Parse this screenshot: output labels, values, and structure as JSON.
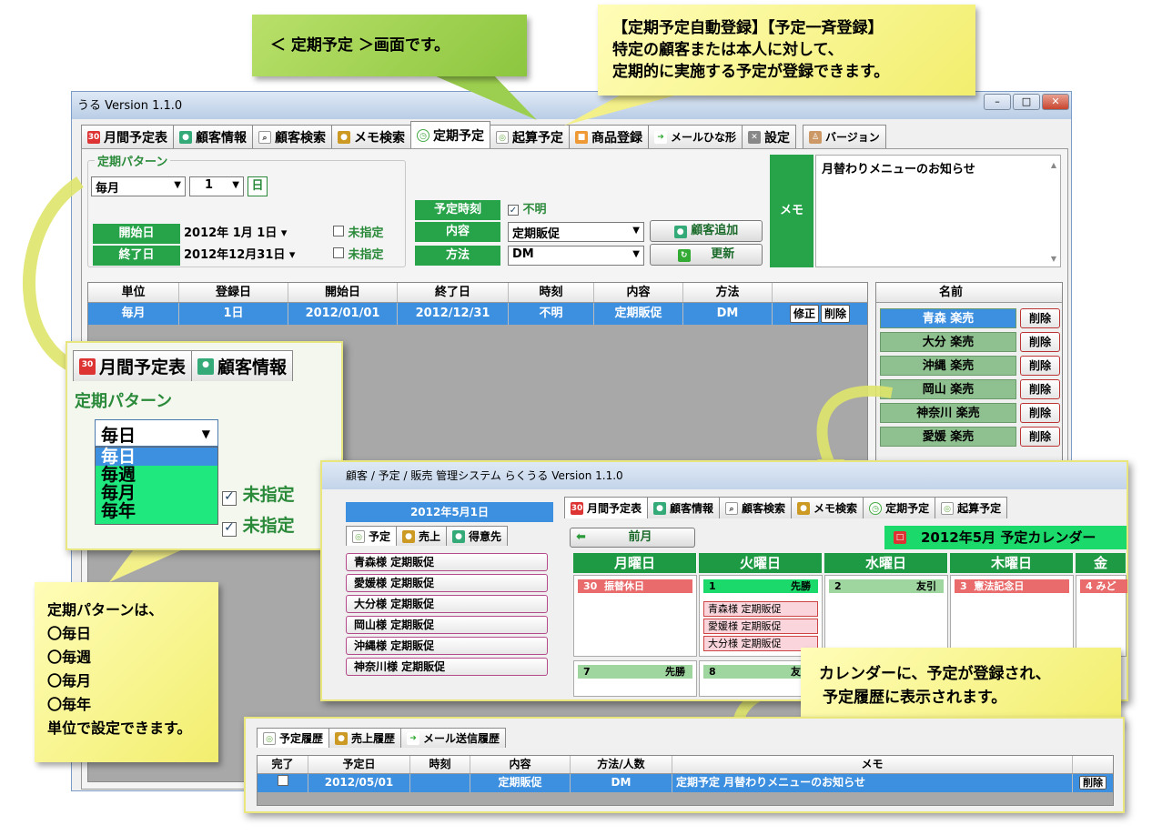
{
  "main_window": {
    "title": "うる Version 1.1.0",
    "tabs": [
      {
        "label": "月間予定表",
        "icon": "calendar-icon"
      },
      {
        "label": "顧客情報",
        "icon": "people-icon"
      },
      {
        "label": "顧客検索",
        "icon": "search-icon"
      },
      {
        "label": "メモ検索",
        "icon": "memo-search-icon"
      },
      {
        "label": "定期予定",
        "icon": "clock-icon"
      },
      {
        "label": "起算予定",
        "icon": "count-icon"
      },
      {
        "label": "商品登録",
        "icon": "gift-icon"
      },
      {
        "label": "メールひな形",
        "icon": "mail-icon"
      },
      {
        "label": "設定",
        "icon": "tools-icon"
      },
      {
        "label": "バージョン",
        "icon": "version-icon"
      }
    ],
    "active_tab": "定期予定",
    "pattern_group_label": "定期パターン",
    "pattern_unit": "毎月",
    "pattern_count": "1",
    "pattern_day_label": "日",
    "start_label": "開始日",
    "start_value": "2012年 1月 1日",
    "end_label": "終了日",
    "end_value": "2012年12月31日",
    "unspecified_label": "未指定",
    "time_label": "予定時刻",
    "time_unknown_label": "不明",
    "content_label": "内容",
    "content_value": "定期販促",
    "method_label": "方法",
    "method_value": "DM",
    "add_customer_label": "顧客追加",
    "update_label": "更新",
    "memo_label": "メモ",
    "memo_text": "月替わりメニューのお知らせ",
    "schedule_table": {
      "headers": [
        "単位",
        "登録日",
        "開始日",
        "終了日",
        "時刻",
        "内容",
        "方法"
      ],
      "rows": [
        {
          "cells": [
            "毎月",
            "1日",
            "2012/01/01",
            "2012/12/31",
            "不明",
            "定期販促",
            "DM"
          ],
          "edit": "修正",
          "delete": "削除"
        }
      ]
    },
    "name_table": {
      "header": "名前",
      "rows": [
        {
          "name": "青森 楽売",
          "delete": "削除"
        },
        {
          "name": "大分 楽売",
          "delete": "削除"
        },
        {
          "name": "沖縄 楽売",
          "delete": "削除"
        },
        {
          "name": "岡山 楽売",
          "delete": "削除"
        },
        {
          "name": "神奈川 楽売",
          "delete": "削除"
        },
        {
          "name": "愛媛 楽売",
          "delete": "削除"
        }
      ]
    }
  },
  "zoom_inset": {
    "tab1": "月間予定表",
    "tab2": "顧客情報",
    "group_label": "定期パターン",
    "selected": "毎日",
    "options": [
      "毎日",
      "毎週",
      "毎月",
      "毎年"
    ],
    "unspecified_label": "未指定"
  },
  "calendar_window": {
    "title": "顧客 / 予定 / 販売 管理システム らくうる Version 1.1.0",
    "date_header": "2012年5月1日",
    "side_tabs": [
      "予定",
      "売上",
      "得意先"
    ],
    "schedule_items": [
      "青森様 定期販促",
      "愛媛様 定期販促",
      "大分様 定期販促",
      "岡山様 定期販促",
      "沖縄様 定期販促",
      "神奈川様 定期販促"
    ],
    "tabs": [
      "月間予定表",
      "顧客情報",
      "顧客検索",
      "メモ検索",
      "定期予定",
      "起算予定"
    ],
    "prev_month_label": "前月",
    "month_title": "2012年5月 予定カレンダー",
    "weekdays": [
      "月曜日",
      "火曜日",
      "水曜日",
      "木曜日",
      "金"
    ],
    "week1": [
      {
        "day": "30",
        "label": "振替休日",
        "color": "#e96b6b"
      },
      {
        "day": "1",
        "label": "先勝",
        "color": "#1bd96a"
      },
      {
        "day": "2",
        "label": "友引",
        "color": "#9fd6a0"
      },
      {
        "day": "3",
        "label": "憲法記念日",
        "color": "#e96b6b"
      },
      {
        "day": "4",
        "label": "みど",
        "color": "#e96b6b"
      }
    ],
    "tuesday_events": [
      "青森様 定期販促",
      "愛媛様 定期販促",
      "大分様 定期販促"
    ],
    "week2": [
      {
        "day": "7",
        "label": "先勝"
      },
      {
        "day": "8",
        "label": "友引"
      }
    ]
  },
  "history_window": {
    "tabs": [
      "予定履歴",
      "売上履歴",
      "メール送信履歴"
    ],
    "headers": [
      "完了",
      "予定日",
      "時刻",
      "内容",
      "方法/人数",
      "メモ"
    ],
    "row": {
      "date": "2012/05/01",
      "time": "",
      "content": "定期販促",
      "method": "DM",
      "memo": "定期予定 月替わりメニューのお知らせ",
      "delete": "削除"
    }
  },
  "callouts": {
    "screen_title": "＜ 定期予定 ＞画面です。",
    "top_right": [
      "【定期予定自動登録】【予定一斉登録】",
      "特定の顧客または本人に対して、",
      "定期的に実施する予定が登録できます。"
    ],
    "pattern_note": [
      "定期パターンは、",
      "〇毎日",
      "〇毎週",
      "〇毎月",
      "〇毎年",
      "単位で設定できます。"
    ],
    "calendar_note": [
      "カレンダーに、予定が登録され、",
      "予定履歴に表示されます。"
    ]
  },
  "colors": {
    "accent_green": "#27a34a",
    "selection_blue": "#3d8fe0",
    "callout_yellow": "#f7f48a",
    "callout_green": "#8cc63f"
  }
}
